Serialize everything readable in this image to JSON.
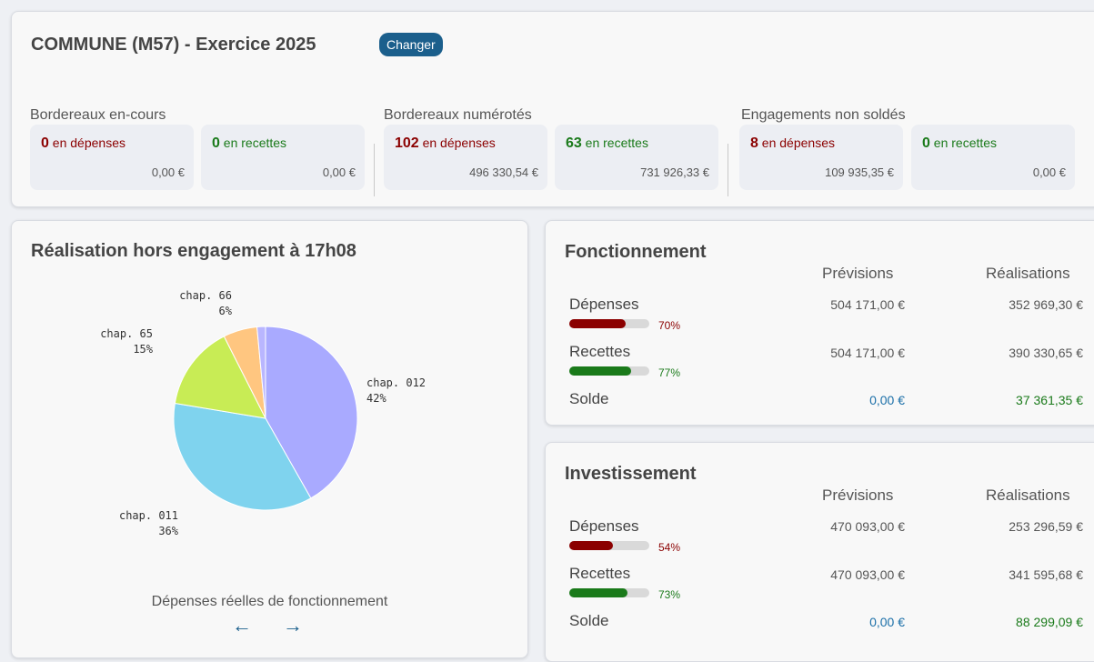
{
  "header": {
    "title": "COMMUNE (M57)  - Exercice 2025",
    "change_label": "Changer"
  },
  "groups": [
    {
      "label": "Bordereaux en-cours",
      "depenses": {
        "count": "0",
        "suffix": " en dépenses",
        "amount": "0,00 €"
      },
      "recettes": {
        "count": "0",
        "suffix": " en recettes",
        "amount": "0,00 €"
      }
    },
    {
      "label": "Bordereaux numérotés",
      "depenses": {
        "count": "102",
        "suffix": " en dépenses",
        "amount": "496 330,54 €"
      },
      "recettes": {
        "count": "63",
        "suffix": " en recettes",
        "amount": "731 926,33 €"
      }
    },
    {
      "label": "Engagements non soldés",
      "depenses": {
        "count": "8",
        "suffix": " en dépenses",
        "amount": "109 935,35 €"
      },
      "recettes": {
        "count": "0",
        "suffix": " en recettes",
        "amount": "0,00 €"
      }
    }
  ],
  "pie": {
    "title": "Réalisation hors engagement à 17h08",
    "caption": "Dépenses réelles de fonctionnement",
    "prev_icon": "arrow-left-icon",
    "next_icon": "arrow-right-icon"
  },
  "chart_data": {
    "type": "pie",
    "title": "Réalisation hors engagement à 17h08",
    "slices": [
      {
        "label": "chap. 012",
        "value": 42,
        "pct_label": "42%",
        "color": "#a9aaff"
      },
      {
        "label": "chap. 011",
        "value": 36,
        "pct_label": "36%",
        "color": "#7fd3ee"
      },
      {
        "label": "chap. 65",
        "value": 15,
        "pct_label": "15%",
        "color": "#c8ec55"
      },
      {
        "label": "chap. 66",
        "value": 6,
        "pct_label": "6%",
        "color": "#ffc680"
      },
      {
        "label": "",
        "value": 1.5,
        "pct_label": "",
        "color": "#b9b6ff"
      }
    ]
  },
  "fonctionnement": {
    "title": "Fonctionnement",
    "col_prev": "Prévisions",
    "col_real": "Réalisations",
    "depenses": {
      "label": "Dépenses",
      "prev": "504 171,00 €",
      "real": "352 969,30 €",
      "pct_label": "70%",
      "fraction": 0.7
    },
    "recettes": {
      "label": "Recettes",
      "prev": "504 171,00 €",
      "real": "390 330,65 €",
      "pct_label": "77%",
      "fraction": 0.77
    },
    "solde": {
      "label": "Solde",
      "prev": "0,00 €",
      "real": "37 361,35 €"
    }
  },
  "investissement": {
    "title": "Investissement",
    "col_prev": "Prévisions",
    "col_real": "Réalisations",
    "depenses": {
      "label": "Dépenses",
      "prev": "470 093,00 €",
      "real": "253 296,59 €",
      "pct_label": "54%",
      "fraction": 0.54
    },
    "recettes": {
      "label": "Recettes",
      "prev": "470 093,00 €",
      "real": "341 595,68 €",
      "pct_label": "73%",
      "fraction": 0.73
    },
    "solde": {
      "label": "Solde",
      "prev": "0,00 €",
      "real": "88 299,09 €"
    }
  },
  "colors": {
    "depense": "#8b0000",
    "recette": "#1a7a1a",
    "accent": "#1b5f8c",
    "solde_prev": "#1b6fa8"
  }
}
